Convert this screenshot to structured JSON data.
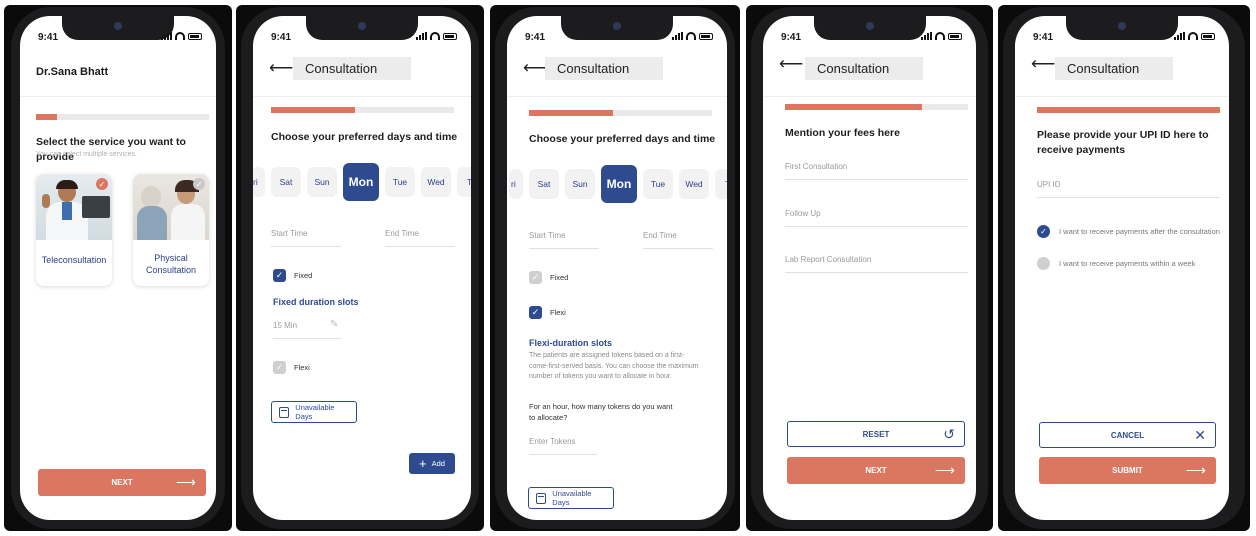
{
  "status_time": "9:41",
  "colors": {
    "accent": "#db7661",
    "primary": "#2e4b8f"
  },
  "screen1": {
    "doctor_name": "Dr.Sana Bhatt",
    "progress": 0.12,
    "heading": "Select the service you want to provide",
    "subtext": "You can select multiple services.",
    "cards": [
      {
        "label": "Teleconsultation",
        "selected": true
      },
      {
        "label": "Physical Consultation",
        "selected": false
      }
    ],
    "next_label": "NEXT",
    "next_icon": "arrow-right-icon"
  },
  "screen2": {
    "title": "Consultation",
    "progress": 0.46,
    "heading": "Choose your preferred days and time",
    "days": [
      "ri",
      "Sat",
      "Sun",
      "Mon",
      "Tue",
      "Wed",
      "Th"
    ],
    "active_day": "Mon",
    "start_placeholder": "Start Time",
    "end_placeholder": "End Time",
    "fixed_label": "Fixed",
    "fixed_title": "Fixed duration slots",
    "duration_value": "15 Min",
    "flexi_label": "Flexi",
    "unavailable_label": "Unavailable Days",
    "add_label": "Add"
  },
  "screen3": {
    "title": "Consultation",
    "progress": 0.46,
    "heading": "Choose your preferred days and time",
    "days": [
      "ri",
      "Sat",
      "Sun",
      "Mon",
      "Tue",
      "Wed",
      "Th"
    ],
    "active_day": "Mon",
    "start_placeholder": "Start Time",
    "end_placeholder": "End Time",
    "fixed_label": "Fixed",
    "flexi_label": "Flexi",
    "flexi_title": "Flexi-duration slots",
    "flexi_desc": "The patients are assigned tokens based on a first-come-first-served basis. You can choose the maximum number of tokens you want to allocate in hour.",
    "question": "For an hour, how many tokens do you want to allocate?",
    "tokens_placeholder": "Enter Tokens",
    "unavailable_label": "Unavailable Days"
  },
  "screen4": {
    "title": "Consultation",
    "progress": 0.75,
    "heading": "Mention your fees here",
    "fields": [
      "First Consultation",
      "Follow Up",
      "Lab Report Consultation"
    ],
    "reset_label": "RESET",
    "next_label": "NEXT"
  },
  "screen5": {
    "title": "Consultation",
    "progress": 1.0,
    "heading": "Please provide your UPI ID here to receive payments",
    "upi_placeholder": "UPI ID",
    "options": [
      {
        "label": "I want to receive payments after the consultation",
        "selected": true
      },
      {
        "label": "I want to receive payments within a week",
        "selected": false
      }
    ],
    "cancel_label": "CANCEL",
    "submit_label": "SUBMIT"
  }
}
